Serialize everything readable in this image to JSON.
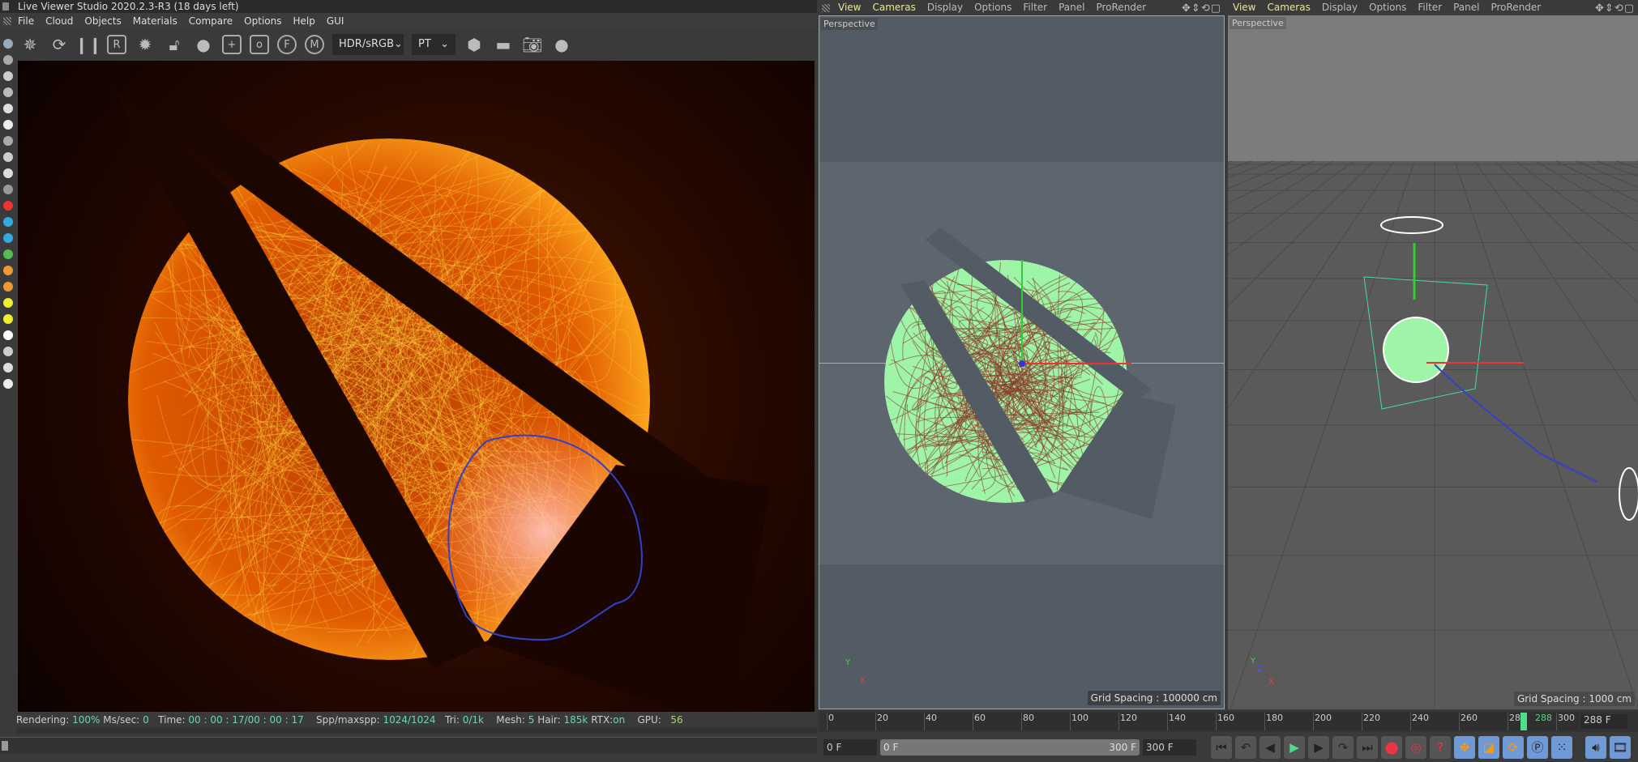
{
  "app": {
    "title": "Live Viewer Studio 2020.2.3-R3 (18 days left)"
  },
  "menu": [
    "File",
    "Cloud",
    "Objects",
    "Materials",
    "Compare",
    "Options",
    "Help",
    "GUI"
  ],
  "toolbar": {
    "icons": [
      "render-icon",
      "refresh-icon",
      "pause-icon",
      "r-icon",
      "gear-icon",
      "unlock-icon",
      "sphere-icon",
      "add-region-icon",
      "zero-region-icon",
      "f-pin-icon",
      "m-pin-icon"
    ],
    "r_label": "R",
    "add_label": "+",
    "zero_label": "o",
    "f_label": "F",
    "m_label": "M",
    "color_mode": "HDR/sRGB",
    "kernel": "PT"
  },
  "status": {
    "rendering_label": "Rendering:",
    "rendering": "100%",
    "mssec_label": "Ms/sec:",
    "mssec": "0",
    "time_label": "Time:",
    "time": "00 : 00 : 17/00 : 00 : 17",
    "spp_label": "Spp/maxspp:",
    "spp": "1024/1024",
    "tri_label": "Tri:",
    "tri": "0/1k",
    "mesh_label": "Mesh:",
    "mesh": "5",
    "hair_label": "Hair:",
    "hair": "185k",
    "rtx_label": "RTX:",
    "rtx": "on",
    "gpu_label": "GPU:",
    "gpu": "56"
  },
  "viewports": [
    {
      "menu": [
        "View",
        "Cameras",
        "Display",
        "Options",
        "Filter",
        "Panel",
        "ProRender"
      ],
      "camera": "Perspective",
      "grid": "Grid Spacing : 100000 cm"
    },
    {
      "menu": [
        "View",
        "Cameras",
        "Display",
        "Options",
        "Filter",
        "Panel",
        "ProRender"
      ],
      "camera": "Perspective",
      "grid": "Grid Spacing : 1000 cm"
    }
  ],
  "axes": {
    "x": "X",
    "y": "Y",
    "z": "Z"
  },
  "timeline": {
    "ticks": [
      "0",
      "20",
      "40",
      "60",
      "80",
      "100",
      "120",
      "140",
      "160",
      "180",
      "200",
      "220",
      "240",
      "260",
      "280",
      "300"
    ],
    "current_marker": "288",
    "current_field": "288 F",
    "start_field": "0 F",
    "range_start": "0 F",
    "range_end": "300 F",
    "end_field": "300 F"
  },
  "colors": {
    "accent_green": "#4fdc86",
    "render_orange": "#ff8a10",
    "hair_green": "#9ef5a8",
    "outline_blue": "#3440c8"
  }
}
